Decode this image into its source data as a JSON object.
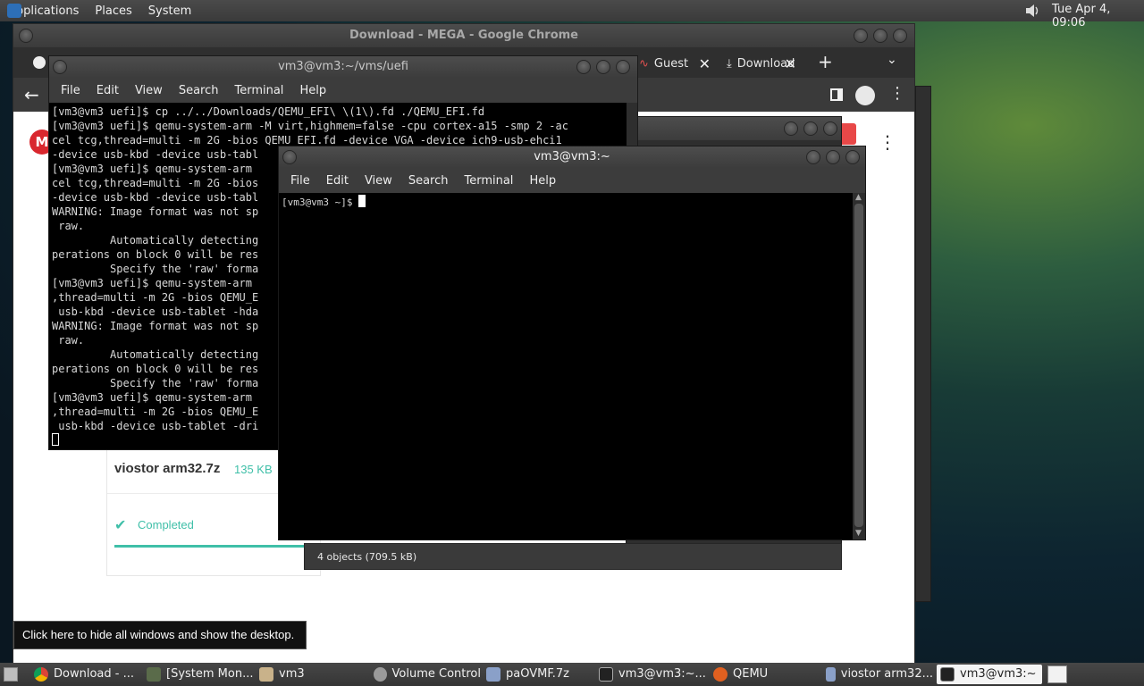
{
  "top_panel": {
    "menus": [
      "Applications",
      "Places",
      "System"
    ],
    "clock": "Tue Apr  4, 09:06"
  },
  "chrome": {
    "title": "Download - MEGA - Google Chrome",
    "tabs": [
      {
        "label": "Guest"
      },
      {
        "label": "Download"
      }
    ],
    "download": {
      "file_name": "viostor arm32.7z",
      "file_size": "135 KB",
      "status": "Completed"
    }
  },
  "file_manager": {
    "status": "4 objects (709.5 kB)"
  },
  "terminal_back": {
    "title": "vm3@vm3:~/vms/uefi",
    "menu": [
      "File",
      "Edit",
      "View",
      "Search",
      "Terminal",
      "Help"
    ],
    "lines": [
      "[vm3@vm3 uefi]$ cp ../../Downloads/QEMU_EFI\\ \\(1\\).fd ./QEMU_EFI.fd",
      "[vm3@vm3 uefi]$ qemu-system-arm -M virt,highmem=false -cpu cortex-a15 -smp 2 -ac",
      "cel tcg,thread=multi -m 2G -bios QEMU_EFI.fd -device VGA -device ich9-usb-ehci1",
      "-device usb-kbd -device usb-tabl",
      "[vm3@vm3 uefi]$ qemu-system-arm ",
      "cel tcg,thread=multi -m 2G -bios",
      "-device usb-kbd -device usb-tabl",
      "WARNING: Image format was not sp",
      " raw.",
      "         Automatically detecting",
      "perations on block 0 will be res",
      "         Specify the 'raw' forma",
      "[vm3@vm3 uefi]$ qemu-system-arm ",
      ",thread=multi -m 2G -bios QEMU_E",
      " usb-kbd -device usb-tablet -hda",
      "WARNING: Image format was not sp",
      " raw.",
      "         Automatically detecting",
      "perations on block 0 will be res",
      "         Specify the 'raw' forma",
      "[vm3@vm3 uefi]$ qemu-system-arm ",
      ",thread=multi -m 2G -bios QEMU_E",
      " usb-kbd -device usb-tablet -dri"
    ]
  },
  "terminal_front": {
    "title": "vm3@vm3:~",
    "menu": [
      "File",
      "Edit",
      "View",
      "Search",
      "Terminal",
      "Help"
    ],
    "prompt": "[vm3@vm3 ~]$ "
  },
  "tooltip": "Click here to hide all windows and show the desktop.",
  "taskbar": {
    "items": [
      {
        "label": "Download - ...",
        "icon": "chrome-icon"
      },
      {
        "label": "[System Mon...",
        "icon": "system-monitor-icon"
      },
      {
        "label": "vm3",
        "icon": "folder-icon"
      },
      {
        "label": "Volume Control",
        "icon": "volume-icon"
      },
      {
        "label": "paOVMF.7z",
        "icon": "archive-icon"
      },
      {
        "label": "vm3@vm3:~...",
        "icon": "terminal-icon"
      },
      {
        "label": "QEMU",
        "icon": "qemu-icon"
      },
      {
        "label": "viostor arm32...",
        "icon": "archive-icon"
      },
      {
        "label": "vm3@vm3:~",
        "icon": "terminal-icon"
      }
    ]
  }
}
